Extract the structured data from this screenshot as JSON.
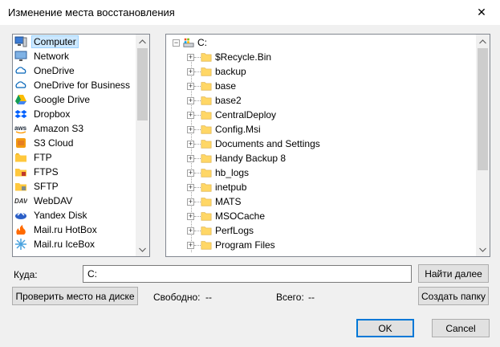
{
  "window": {
    "title": "Изменение места восстановления",
    "close_glyph": "✕"
  },
  "locations": [
    {
      "label": "Computer",
      "icon": "computer-icon",
      "selected": true
    },
    {
      "label": "Network",
      "icon": "network-icon"
    },
    {
      "label": "OneDrive",
      "icon": "onedrive-icon"
    },
    {
      "label": "OneDrive for Business",
      "icon": "onedrive-business-icon"
    },
    {
      "label": "Google Drive",
      "icon": "google-drive-icon"
    },
    {
      "label": "Dropbox",
      "icon": "dropbox-icon"
    },
    {
      "label": "Amazon S3",
      "icon": "aws-icon"
    },
    {
      "label": "S3 Cloud",
      "icon": "s3-cloud-icon"
    },
    {
      "label": "FTP",
      "icon": "ftp-folder-icon"
    },
    {
      "label": "FTPS",
      "icon": "ftps-folder-icon"
    },
    {
      "label": "SFTP",
      "icon": "sftp-folder-icon"
    },
    {
      "label": "WebDAV",
      "icon": "webdav-icon"
    },
    {
      "label": "Yandex Disk",
      "icon": "yandex-disk-icon"
    },
    {
      "label": "Mail.ru HotBox",
      "icon": "mailru-hotbox-icon"
    },
    {
      "label": "Mail.ru IceBox",
      "icon": "mailru-icebox-icon"
    }
  ],
  "tree": {
    "root": "C:",
    "folders": [
      "$Recycle.Bin",
      "backup",
      "base",
      "base2",
      "CentralDeploy",
      "Config.Msi",
      "Documents and Settings",
      "Handy Backup 8",
      "hb_logs",
      "inetpub",
      "MATS",
      "MSOCache",
      "PerfLogs",
      "Program Files"
    ]
  },
  "destination": {
    "label": "Куда:",
    "value": "C:"
  },
  "buttons": {
    "find_next": "Найти далее",
    "check_space": "Проверить место на диске",
    "create_folder": "Создать папку",
    "ok": "OK",
    "cancel": "Cancel"
  },
  "space": {
    "free_label": "Свободно:",
    "free_value": "--",
    "total_label": "Всего:",
    "total_value": "--"
  },
  "colors": {
    "selection": "#cce8ff",
    "accent": "#0078d7",
    "folder": "#ffd766"
  }
}
